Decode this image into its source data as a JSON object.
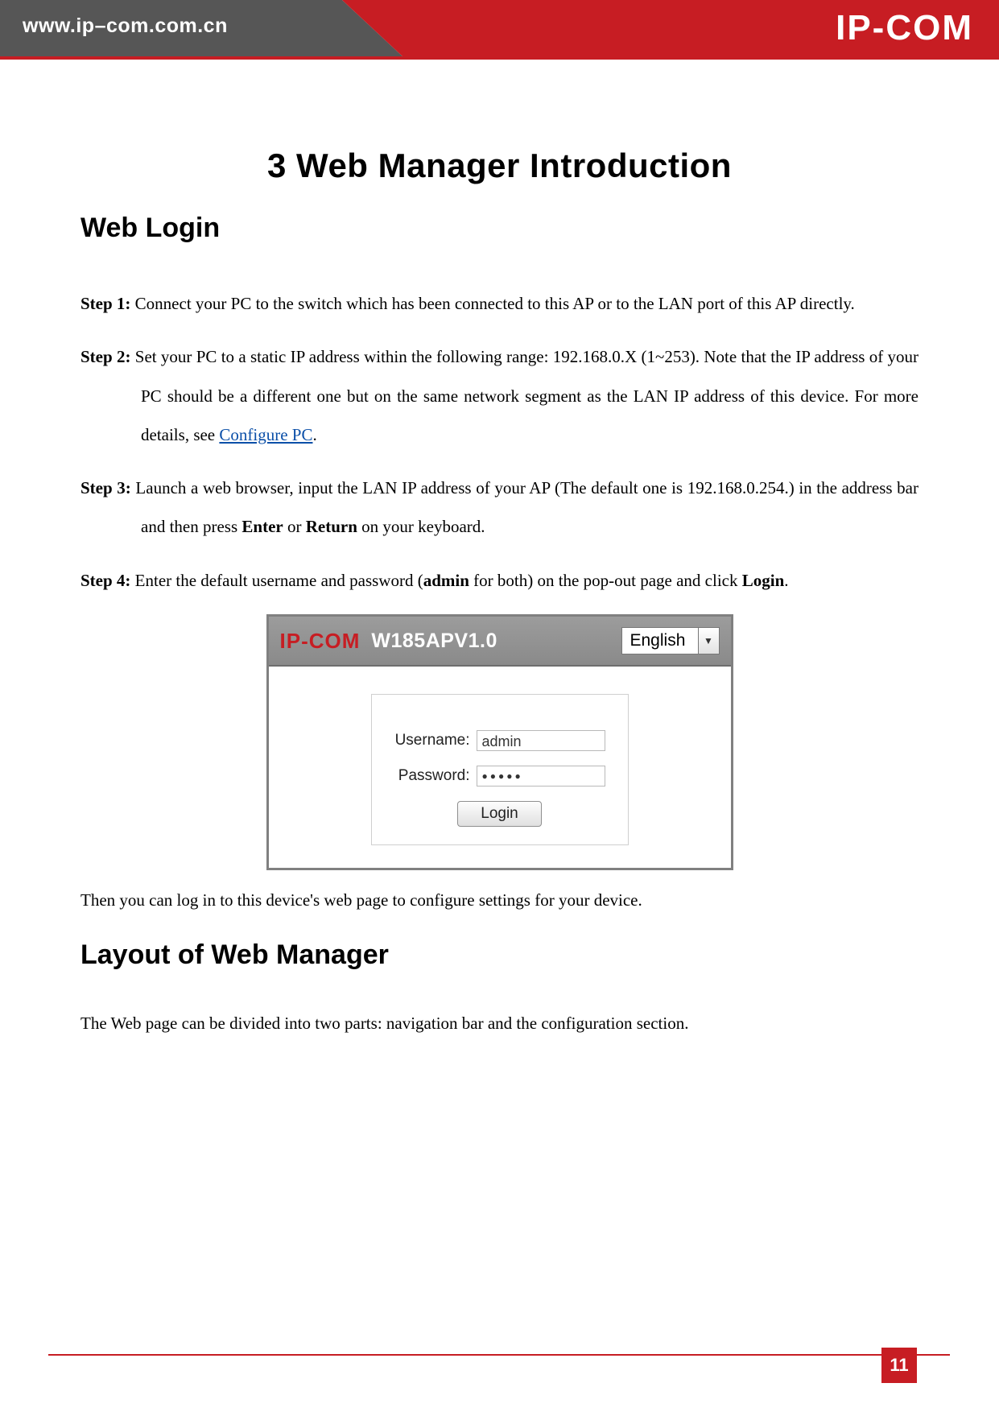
{
  "header": {
    "url": "www.ip–com.com.cn",
    "brand": "IP-COM"
  },
  "chapter_title": "3 Web Manager Introduction",
  "section1_title": "Web Login",
  "steps": {
    "s1_label": "Step 1:",
    "s1_text": " Connect your PC to the switch which has been connected to this AP or to the LAN port of this AP directly.",
    "s2_label": "Step 2:",
    "s2_text_a": " Set your PC to a static IP address within the following range: 192.168.0.X (1~253). Note that the IP address of your PC should be a different one but on the same network segment as the LAN IP address of this device. For more details, see ",
    "s2_link": "Configure PC",
    "s2_text_b": ".",
    "s3_label": "Step 3:",
    "s3_text_a": " Launch a web browser, input the LAN IP address of your AP (The default one is 192.168.0.254.) in the address bar and then press ",
    "s3_bold1": "Enter",
    "s3_mid": " or ",
    "s3_bold2": "Return",
    "s3_text_b": " on your keyboard.",
    "s4_label": "Step 4:",
    "s4_text_a": " Enter the default username and password (",
    "s4_bold1": "admin",
    "s4_text_b": " for both) on the pop-out page and click ",
    "s4_bold2": "Login",
    "s4_text_c": "."
  },
  "login_shot": {
    "brand": "IP-COM",
    "model": "W185APV1.0",
    "language": "English",
    "username_label": "Username:",
    "username_value": "admin",
    "password_label": "Password:",
    "password_value": "●●●●●",
    "login_button": "Login"
  },
  "post_login_text": "Then you can log in to this device's web page to configure settings for your device.",
  "section2_title": "Layout of Web Manager",
  "layout_text": "The Web page can be divided into two parts: navigation bar and the configuration section.",
  "page_number": "11"
}
